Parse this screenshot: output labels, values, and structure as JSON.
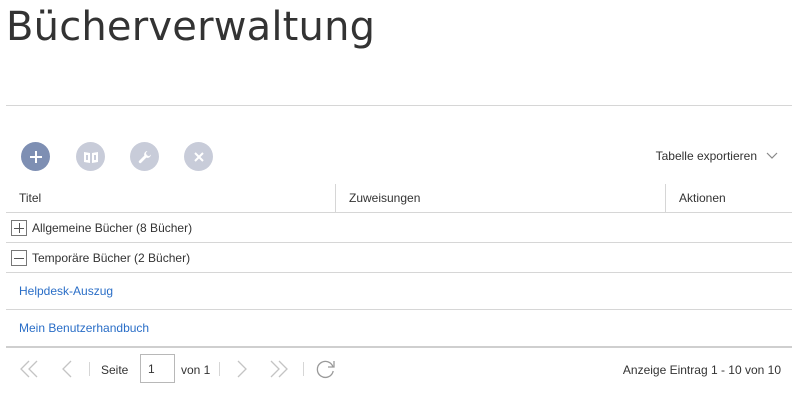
{
  "page": {
    "title": "Bücherverwaltung"
  },
  "toolbar": {
    "buttons": [
      {
        "icon": "plus-icon",
        "enabled": true
      },
      {
        "icon": "books-icon",
        "enabled": false
      },
      {
        "icon": "wrench-icon",
        "enabled": false
      },
      {
        "icon": "close-icon",
        "enabled": false
      }
    ],
    "export_label": "Tabelle exportieren"
  },
  "table": {
    "columns": [
      "Titel",
      "Zuweisungen",
      "Aktionen"
    ],
    "groups": [
      {
        "label": "Allgemeine Bücher (8 Bücher)",
        "expanded": false,
        "items": []
      },
      {
        "label": "Temporäre Bücher (2 Bücher)",
        "expanded": true,
        "items": [
          "Helpdesk-Auszug",
          "Mein Benutzerhandbuch"
        ]
      }
    ]
  },
  "pager": {
    "page_label": "Seite",
    "page_value": "1",
    "of_label": "von 1",
    "range_info": "Anzeige Eintrag 1 - 10 von 10"
  },
  "colors": {
    "primary_button": "#7e8fb3",
    "disabled_button": "#c8ccd9",
    "link": "#2a6ec7",
    "border": "#d6d6d6"
  }
}
